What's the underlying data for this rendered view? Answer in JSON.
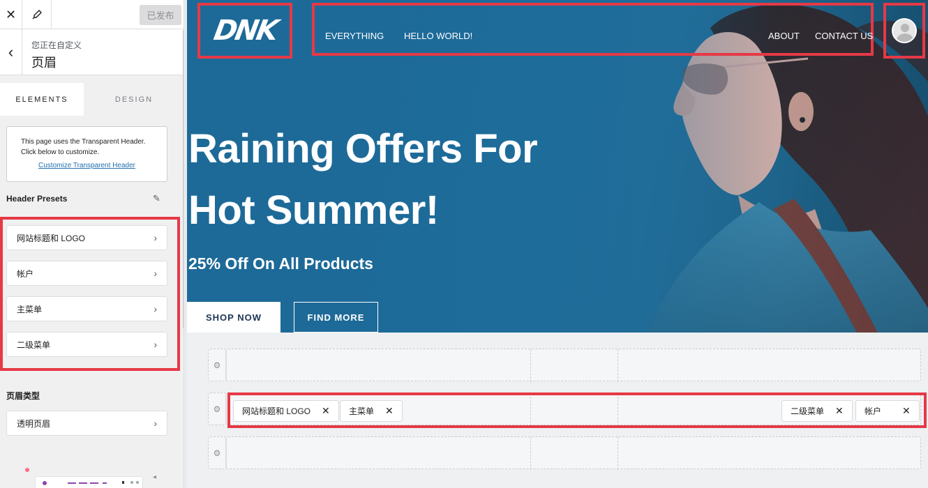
{
  "sidebar": {
    "close_label": "✕",
    "publish_label": "已发布",
    "crumb_sub": "您正在自定义",
    "crumb_title": "页眉",
    "tabs": [
      {
        "label": "ELEMENTS"
      },
      {
        "label": "DESIGN"
      }
    ],
    "notice_text": "This page uses the Transparent Header. Click below to customize.",
    "notice_link": "Customize Transparent Header",
    "presets_title": "Header Presets",
    "items": [
      {
        "label": "网站标题和 LOGO"
      },
      {
        "label": "帐户"
      },
      {
        "label": "主菜单"
      },
      {
        "label": "二级菜单"
      }
    ],
    "type_title": "页眉类型",
    "type_item": "透明页眉"
  },
  "preview": {
    "logo": "DNK",
    "nav_left": [
      "EVERYTHING",
      "HELLO WORLD!"
    ],
    "nav_right": [
      "ABOUT",
      "CONTACT US"
    ],
    "hero_line1": "Raining Offers For",
    "hero_line2": "Hot Summer!",
    "hero_sub": "25% Off On All Products",
    "btn_shop": "SHOP NOW",
    "btn_find": "FIND MORE"
  },
  "builder": {
    "chips_left": [
      "网站标题和 LOGO",
      "主菜单"
    ],
    "chips_right": [
      "二级菜单",
      "帐户"
    ]
  },
  "colors": {
    "accent_red": "#e63946",
    "hero_blue": "#1e6e9c",
    "link_blue": "#2271b1"
  }
}
